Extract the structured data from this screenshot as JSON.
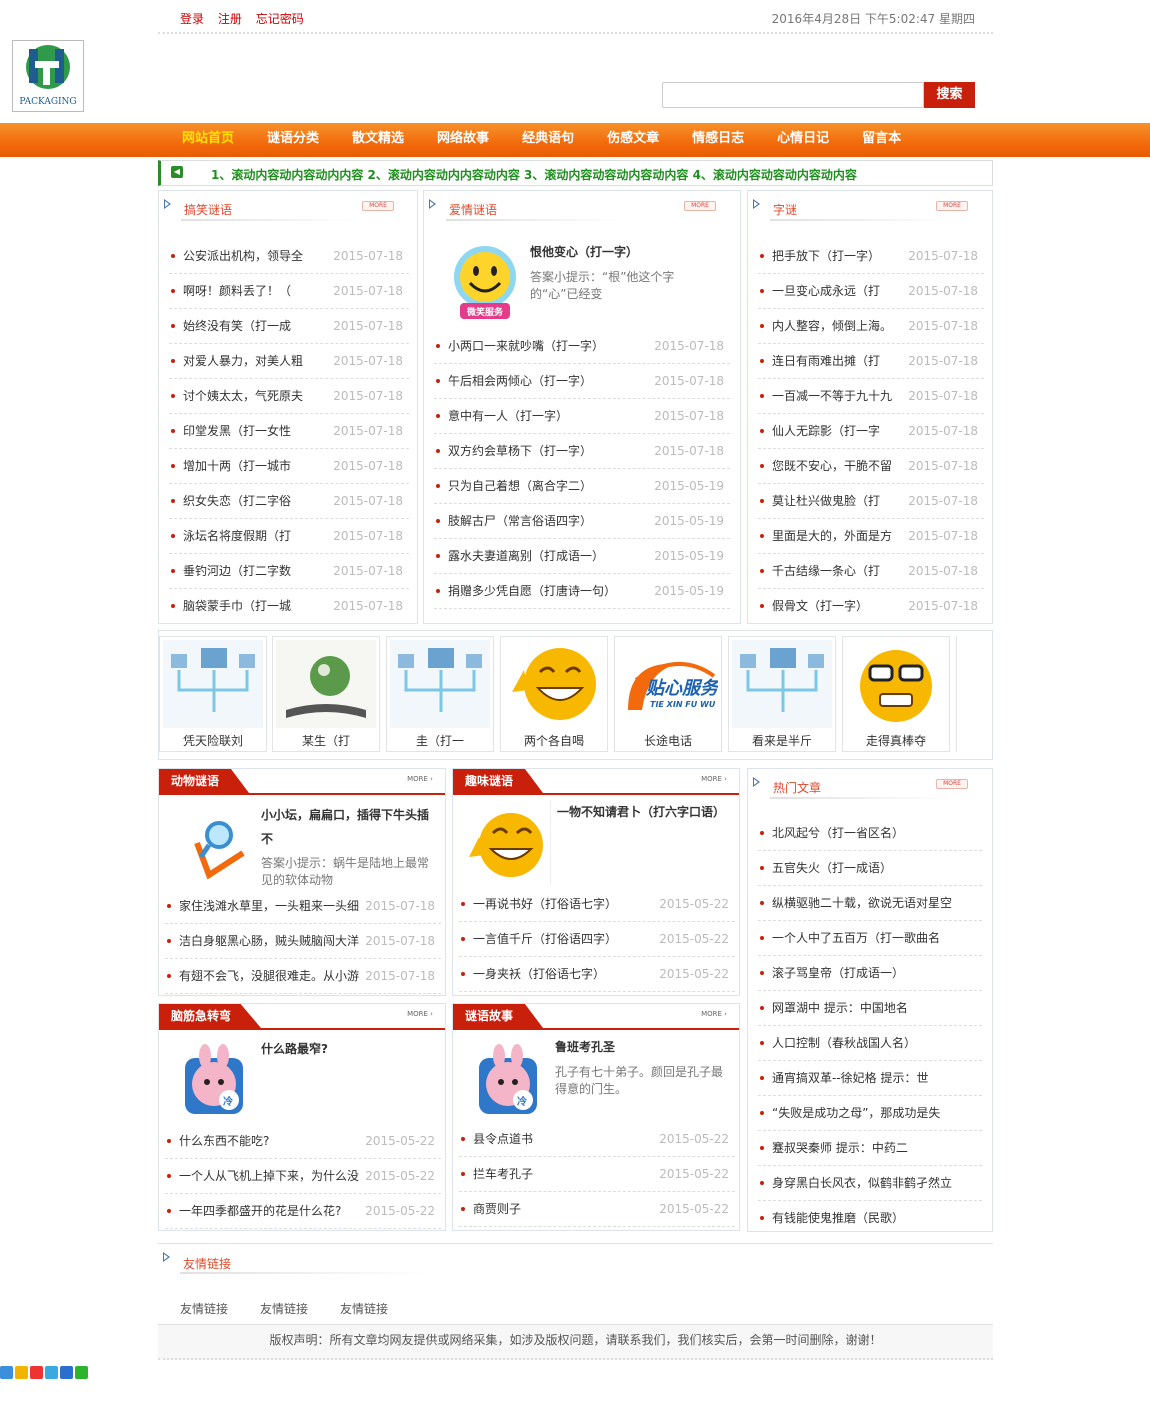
{
  "top": {
    "links": [
      "登录",
      "注册",
      "忘记密码"
    ],
    "clock": "2016年4月28日 下午5:02:47 星期四"
  },
  "logo": {
    "text": "PACKAGING"
  },
  "search": {
    "placeholder": "",
    "button": "搜索"
  },
  "nav": [
    "网站首页",
    "谜语分类",
    "散文精选",
    "网络故事",
    "经典语句",
    "伤感文章",
    "情感日志",
    "心情日记",
    "留言本"
  ],
  "ticker": "1、滚动内容动内容动内内容 2、滚动内容动内内容动内容 3、滚动内容动容动内容动内容 4、滚动内容动容动内容动内容",
  "box1": {
    "title": "搞笑谜语",
    "more": "MORE",
    "items": [
      {
        "t": "公安派出机构，领导全",
        "d": "2015-07-18"
      },
      {
        "t": "啊呀！颜料丢了！（",
        "d": "2015-07-18"
      },
      {
        "t": "始终没有笑（打一成",
        "d": "2015-07-18"
      },
      {
        "t": "对爱人暴力，对美人粗",
        "d": "2015-07-18"
      },
      {
        "t": "讨个姨太太，气死原夫",
        "d": "2015-07-18"
      },
      {
        "t": "印堂发黑（打一女性",
        "d": "2015-07-18"
      },
      {
        "t": "增加十两（打一城市",
        "d": "2015-07-18"
      },
      {
        "t": "织女失恋（打二字俗",
        "d": "2015-07-18"
      },
      {
        "t": "泳坛名将度假期（打",
        "d": "2015-07-18"
      },
      {
        "t": "垂钓河边（打二字数",
        "d": "2015-07-18"
      },
      {
        "t": "脑袋蒙手巾（打一城",
        "d": "2015-07-18"
      }
    ]
  },
  "box2": {
    "title": "爱情谜语",
    "more": "MORE",
    "feat_title": "恨他变心（打一字）",
    "feat_desc": "答案小提示：“根”他这个字的“心”已经变",
    "badge": "微笑服务",
    "items": [
      {
        "t": "小两口一来就吵嘴（打一字）",
        "d": "2015-07-18"
      },
      {
        "t": "午后相会两倾心（打一字）",
        "d": "2015-07-18"
      },
      {
        "t": "意中有一人（打一字）",
        "d": "2015-07-18"
      },
      {
        "t": "双方约会草杨下（打一字）",
        "d": "2015-07-18"
      },
      {
        "t": "只为自己着想（离合字二）",
        "d": "2015-05-19"
      },
      {
        "t": "肢解古尸（常言俗语四字）",
        "d": "2015-05-19"
      },
      {
        "t": "露水夫妻道离别（打成语一）",
        "d": "2015-05-19"
      },
      {
        "t": "捐赠多少凭自愿（打唐诗一句）",
        "d": "2015-05-19"
      }
    ]
  },
  "box3": {
    "title": "字谜",
    "more": "MORE",
    "items": [
      {
        "t": "把手放下（打一字）",
        "d": "2015-07-18"
      },
      {
        "t": "一旦变心成永远（打",
        "d": "2015-07-18"
      },
      {
        "t": "内人整容，倾倒上海。",
        "d": "2015-07-18"
      },
      {
        "t": "连日有雨难出摊（打",
        "d": "2015-07-18"
      },
      {
        "t": "一百减一不等于九十九",
        "d": "2015-07-18"
      },
      {
        "t": "仙人无踪影（打一字",
        "d": "2015-07-18"
      },
      {
        "t": "您既不安心，干脆不留",
        "d": "2015-07-18"
      },
      {
        "t": "莫让杜兴做鬼脸（打",
        "d": "2015-07-18"
      },
      {
        "t": "里面是大的，外面是方",
        "d": "2015-07-18"
      },
      {
        "t": "千古结缘一条心（打",
        "d": "2015-07-18"
      },
      {
        "t": "假骨文（打一字）",
        "d": "2015-07-18"
      }
    ]
  },
  "thumbs": [
    "凭天险联刘",
    "某生（打",
    "圭（打一",
    "两个各自喝",
    "长途电话",
    "看来是半斤",
    "走得真棒夺"
  ],
  "thumb_logo": {
    "cn": "贴心服务",
    "en": "TIE XIN FU WU"
  },
  "box4": {
    "title": "动物谜语",
    "more": "MORE ›",
    "feat_title": "小小坛，扁扁口，插得下牛头插不",
    "feat_desc": "答案小提示：蜗牛是陆地上最常见的软体动物",
    "items": [
      {
        "t": "家住浅滩水草里，一头粗来一头细",
        "d": "2015-07-18"
      },
      {
        "t": "洁白身躯黑心肠，贼头贼脑闯大洋",
        "d": "2015-07-18"
      },
      {
        "t": "有翅不会飞，没腿很难走。从小游",
        "d": "2015-07-18"
      }
    ]
  },
  "box5": {
    "title": "趣味谜语",
    "more": "MORE ›",
    "feat_title": "一物不知请君卜（打六字口语）",
    "items": [
      {
        "t": "一再说书好（打俗语七字）",
        "d": "2015-05-22"
      },
      {
        "t": "一言值千斤（打俗语四字）",
        "d": "2015-05-22"
      },
      {
        "t": "一身夹袄（打俗语七字）",
        "d": "2015-05-22"
      }
    ]
  },
  "box6": {
    "title": "热门文章",
    "more": "MORE",
    "items": [
      "北风起兮（打一省区名）",
      "五官失火（打一成语）",
      "纵横驱驰二十载，欲说无语对星空",
      "一个人中了五百万（打一歌曲名",
      "滚子骂皇帝（打成语一）",
      "网罩湖中 提示：中国地名",
      "人口控制（春秋战国人名）",
      "通宵搞双革--徐妃格 提示：世",
      "“失败是成功之母”，那成功是失",
      "蹇叔哭秦师 提示：中药二",
      "身穿黑白长风衣，似鹤非鹤孑然立",
      "有钱能使鬼推磨（民歌）"
    ]
  },
  "box7": {
    "title": "脑筋急转弯",
    "more": "MORE ›",
    "feat_title": "什么路最窄?",
    "icon_text": "冷",
    "items": [
      {
        "t": "什么东西不能吃?",
        "d": "2015-05-22"
      },
      {
        "t": "一个人从飞机上掉下来，为什么没",
        "d": "2015-05-22"
      },
      {
        "t": "一年四季都盛开的花是什么花?",
        "d": "2015-05-22"
      }
    ]
  },
  "box8": {
    "title": "谜语故事",
    "more": "MORE ›",
    "feat_title": "鲁班考孔圣",
    "feat_desc": "孔子有七十弟子。颜回是孔子最得意的门生。",
    "icon_text": "冷",
    "items": [
      {
        "t": "县令点道书",
        "d": "2015-05-22"
      },
      {
        "t": "拦车考孔子",
        "d": "2015-05-22"
      },
      {
        "t": "商贾则子",
        "d": "2015-05-22"
      }
    ]
  },
  "links": {
    "title": "友情链接",
    "items": [
      "友情链接",
      "友情链接",
      "友情链接"
    ]
  },
  "footer": "版权声明：所有文章均网友提供或网络采集，如涉及版权问题，请联系我们，我们核实后，会第一时间删除，谢谢！",
  "colors": {
    "accent": "#c9200c",
    "nav": "#f26a0c",
    "ticker": "#1f8f1f"
  }
}
